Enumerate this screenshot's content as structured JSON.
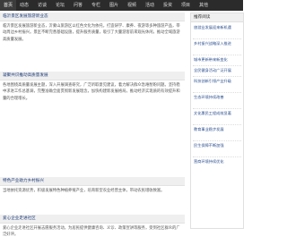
{
  "nav": {
    "items": [
      "首页",
      "动态",
      "访谈",
      "论坛",
      "问答",
      "专栏",
      "图片",
      "视频",
      "活动",
      "投资",
      "项目",
      "其他"
    ]
  },
  "articles": [
    {
      "title": "临沂景区发展旅游新业态",
      "body": "临沂景区发展旅游新业态，沂蒙山旅游区以红色文化为依托，打造研学、康养、夜游等多种旅游产品，带动周边乡村振兴。景区不断完善基础设施，提升服务质量，吸引了大量游客前来观光休闲，推动全域旅游高质量发展。"
    },
    {
      "title": "凝聚共识推动高质量发展",
      "body": "各地围绕高质量发展主题，深入开展调查研究，广泛听取意见建议，着力解决群众急难愁盼问题。坚持稳中求进工作总基调，完整准确全面贯彻新发展理念，加快构建新发展格局，推动经济实现质的有效提升和量的合理增长。"
    },
    {
      "title": "特色产业助力乡村振兴",
      "body": "当地依托资源优势，积极发展特色种植养殖产业，培育新型农业经营主体，带动农民增收致富。"
    },
    {
      "title": "爱心企业走进社区",
      "body": "爱心企业走进社区开展志愿服务活动，为居民提供健康咨询、义诊、政策宣讲等服务，受到社区群众的广泛好评。"
    }
  ],
  "sidebar": {
    "heading": "推荐阅读",
    "items": [
      "旅游业发展迎来新机遇",
      "乡村振兴战略深入推进",
      "城市更新带来新变化",
      "全民健身活动广泛开展",
      "科技创新引领产业升级",
      "生态环境持续改善",
      "文化惠民工程成效显著",
      "教育事业稳步发展",
      "民生保障不断加强",
      "营商环境持续优化"
    ]
  }
}
